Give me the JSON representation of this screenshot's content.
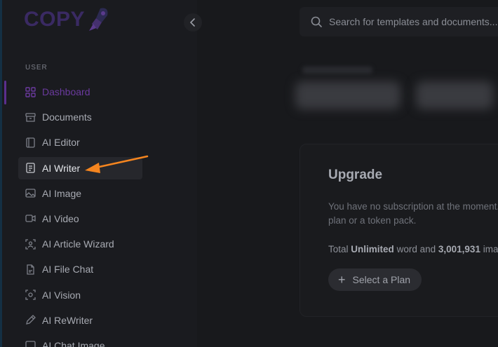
{
  "app": {
    "logo_text": "COPY",
    "brand_color": "#3a2a63",
    "accent_color": "#6b3a9e",
    "highlight_arrow_color": "#f5851f"
  },
  "sidebar": {
    "section_label": "USER",
    "items": [
      {
        "label": "Dashboard",
        "icon": "dashboard-icon",
        "state": "active"
      },
      {
        "label": "Documents",
        "icon": "archive-icon"
      },
      {
        "label": "AI Editor",
        "icon": "notebook-icon"
      },
      {
        "label": "AI Writer",
        "icon": "document-icon",
        "state": "highlighted"
      },
      {
        "label": "AI Image",
        "icon": "image-icon"
      },
      {
        "label": "AI Video",
        "icon": "video-icon"
      },
      {
        "label": "AI Article Wizard",
        "icon": "wizard-icon"
      },
      {
        "label": "AI File Chat",
        "icon": "file-chat-icon"
      },
      {
        "label": "AI Vision",
        "icon": "vision-icon"
      },
      {
        "label": "AI ReWriter",
        "icon": "pen-icon"
      },
      {
        "label": "AI Chat Image",
        "icon": "chat-image-icon"
      }
    ]
  },
  "header": {
    "search_placeholder": "Search for templates and documents..."
  },
  "upgrade_card": {
    "title": "Upgrade",
    "desc_line1": "You have no subscription at the moment. Please select a",
    "desc_line2": "plan or a token pack.",
    "stats_prefix": "Total",
    "stats_words": "Unlimited",
    "stats_mid": "word and",
    "stats_images": "3,001,931",
    "stats_suffix": "image tokens left.",
    "button_label": "Select a Plan"
  }
}
